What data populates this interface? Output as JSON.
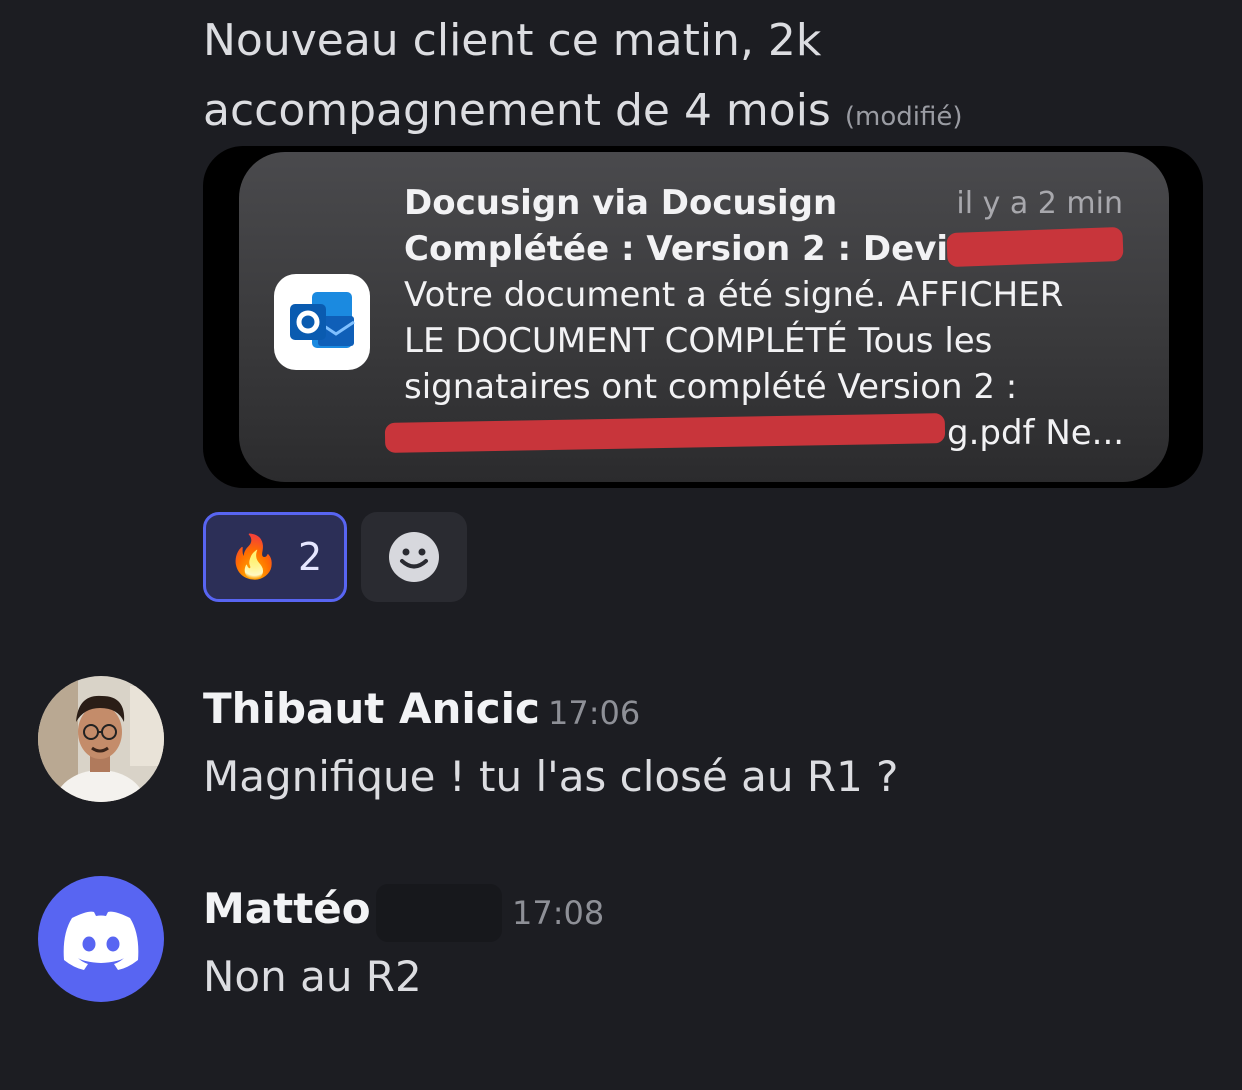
{
  "message": {
    "text": "Nouveau client ce matin, 2k accompagnement de 4 mois",
    "edited_label": "(modifié)"
  },
  "notification": {
    "app_icon": "outlook-icon",
    "sender": "Docusign via Docusign",
    "time": "il y a 2 min",
    "subject": "Complétée : Version 2 : Devis",
    "line1": "Votre document a été signé. AFFICHER",
    "line2": "LE DOCUMENT COMPLÉTÉ Tous les",
    "line3": "signataires ont complété Version 2 :",
    "line4": "g.pdf Ne..."
  },
  "reactions": [
    {
      "emoji": "🔥",
      "count": "2",
      "active": true
    }
  ],
  "add_reaction_icon": "smiley-icon",
  "messages": [
    {
      "author": "Thibaut Anicic",
      "time": "17:06",
      "text": "Magnifique ! tu l'as closé au R1 ?",
      "avatar": "user-photo"
    },
    {
      "author": "Mattéo",
      "time": "17:08",
      "text": "Non au R2",
      "avatar": "discord-logo-icon"
    }
  ],
  "colors": {
    "background": "#1c1d22",
    "accent": "#5865f2",
    "redaction": "#c8353b"
  }
}
